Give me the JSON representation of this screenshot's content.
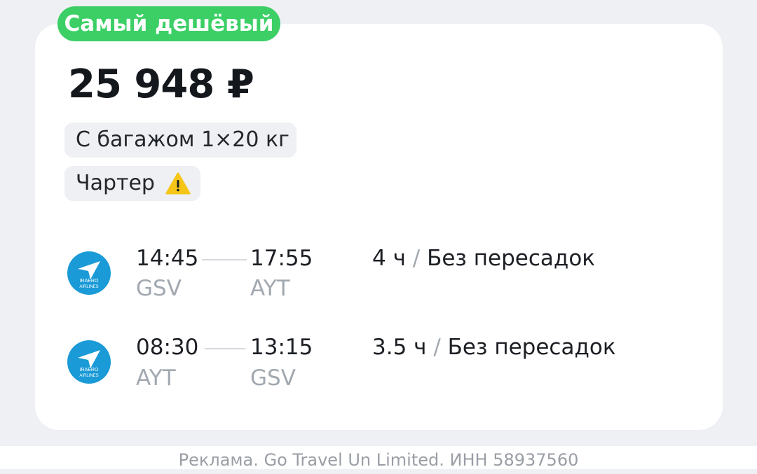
{
  "offer": {
    "badge": "Самый дешёвый",
    "price": "25 948 ₽",
    "baggage": "С багажом 1×20 кг",
    "charter": "Чартер"
  },
  "airline": {
    "logo_text_1": "IRAERO",
    "logo_text_2": "AIRLINES"
  },
  "legs": [
    {
      "depart_time": "14:45",
      "depart_code": "GSV",
      "arrive_time": "17:55",
      "arrive_code": "AYT",
      "duration": "4 ч",
      "stops": "Без пересадок"
    },
    {
      "depart_time": "08:30",
      "depart_code": "AYT",
      "arrive_time": "13:15",
      "arrive_code": "GSV",
      "duration": "3.5 ч",
      "stops": "Без пересадок"
    }
  ],
  "footer": {
    "text": "Реклама. Go Travel Un Limited. ИНН 58937560"
  },
  "colors": {
    "badge": "#3ccf66",
    "warning": "#f5c518",
    "logo": "#1a9ad6"
  },
  "icons": {
    "warning": "warning-icon",
    "airline": "airline-logo"
  }
}
